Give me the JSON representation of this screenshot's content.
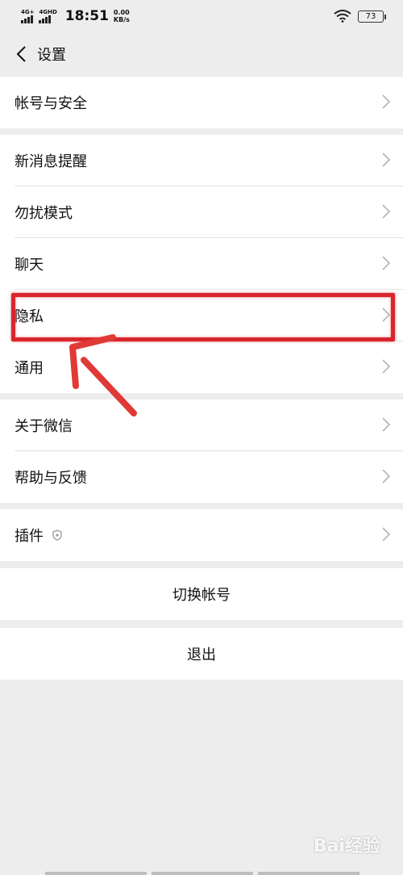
{
  "status_bar": {
    "sim1_label": "4G+",
    "sim2_label": "4GHD",
    "time": "18:51",
    "speed_value": "0.00",
    "speed_unit": "KB/s",
    "battery": "73"
  },
  "nav": {
    "title": "设置"
  },
  "menu": {
    "account_security": "帐号与安全",
    "new_message_alert": "新消息提醒",
    "do_not_disturb": "勿扰模式",
    "chat": "聊天",
    "privacy": "隐私",
    "general": "通用",
    "about_wechat": "关于微信",
    "help_feedback": "帮助与反馈",
    "plugins": "插件"
  },
  "actions": {
    "switch_account": "切换帐号",
    "logout": "退出"
  },
  "watermark": "Bai经验",
  "colors": {
    "highlight": "#d8262c",
    "background": "#ededed"
  },
  "icons": [
    "back-arrow-icon",
    "chevron-right-icon",
    "plugin-shield-icon",
    "wifi-icon",
    "battery-icon"
  ]
}
